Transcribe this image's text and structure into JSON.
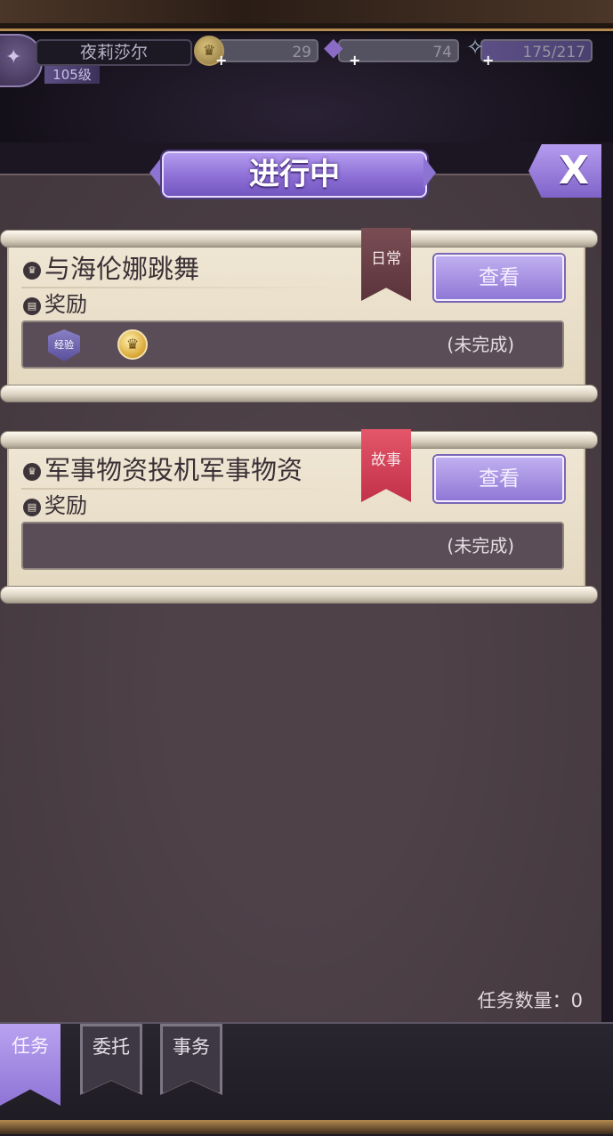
{
  "player": {
    "name": "夜莉莎尔",
    "level": "105级"
  },
  "resources": {
    "gold": "29",
    "gems": "74",
    "energy": "175/217"
  },
  "panel": {
    "title": "进行中",
    "close_label": "X"
  },
  "quests": [
    {
      "title": "与海伦娜跳舞",
      "tag": "日常",
      "reward_label": "奖励",
      "rewards": [
        "经验",
        "♛"
      ],
      "status": "(未完成)",
      "view_label": "查看"
    },
    {
      "title": "军事物资投机军事物资",
      "tag": "故事",
      "reward_label": "奖励",
      "rewards": [],
      "status": "(未完成)",
      "view_label": "查看"
    }
  ],
  "quest_count": "任务数量：0",
  "tabs": [
    "任务",
    "委托",
    "事务"
  ],
  "icons": {
    "gold": "crown-coin-icon",
    "gems": "diamond-icon",
    "energy": "shoe-icon"
  },
  "colors": {
    "accent": "#8f74d6",
    "panel": "#4e4148",
    "daily_tag": "#6a3f46",
    "story_tag": "#d44257"
  }
}
